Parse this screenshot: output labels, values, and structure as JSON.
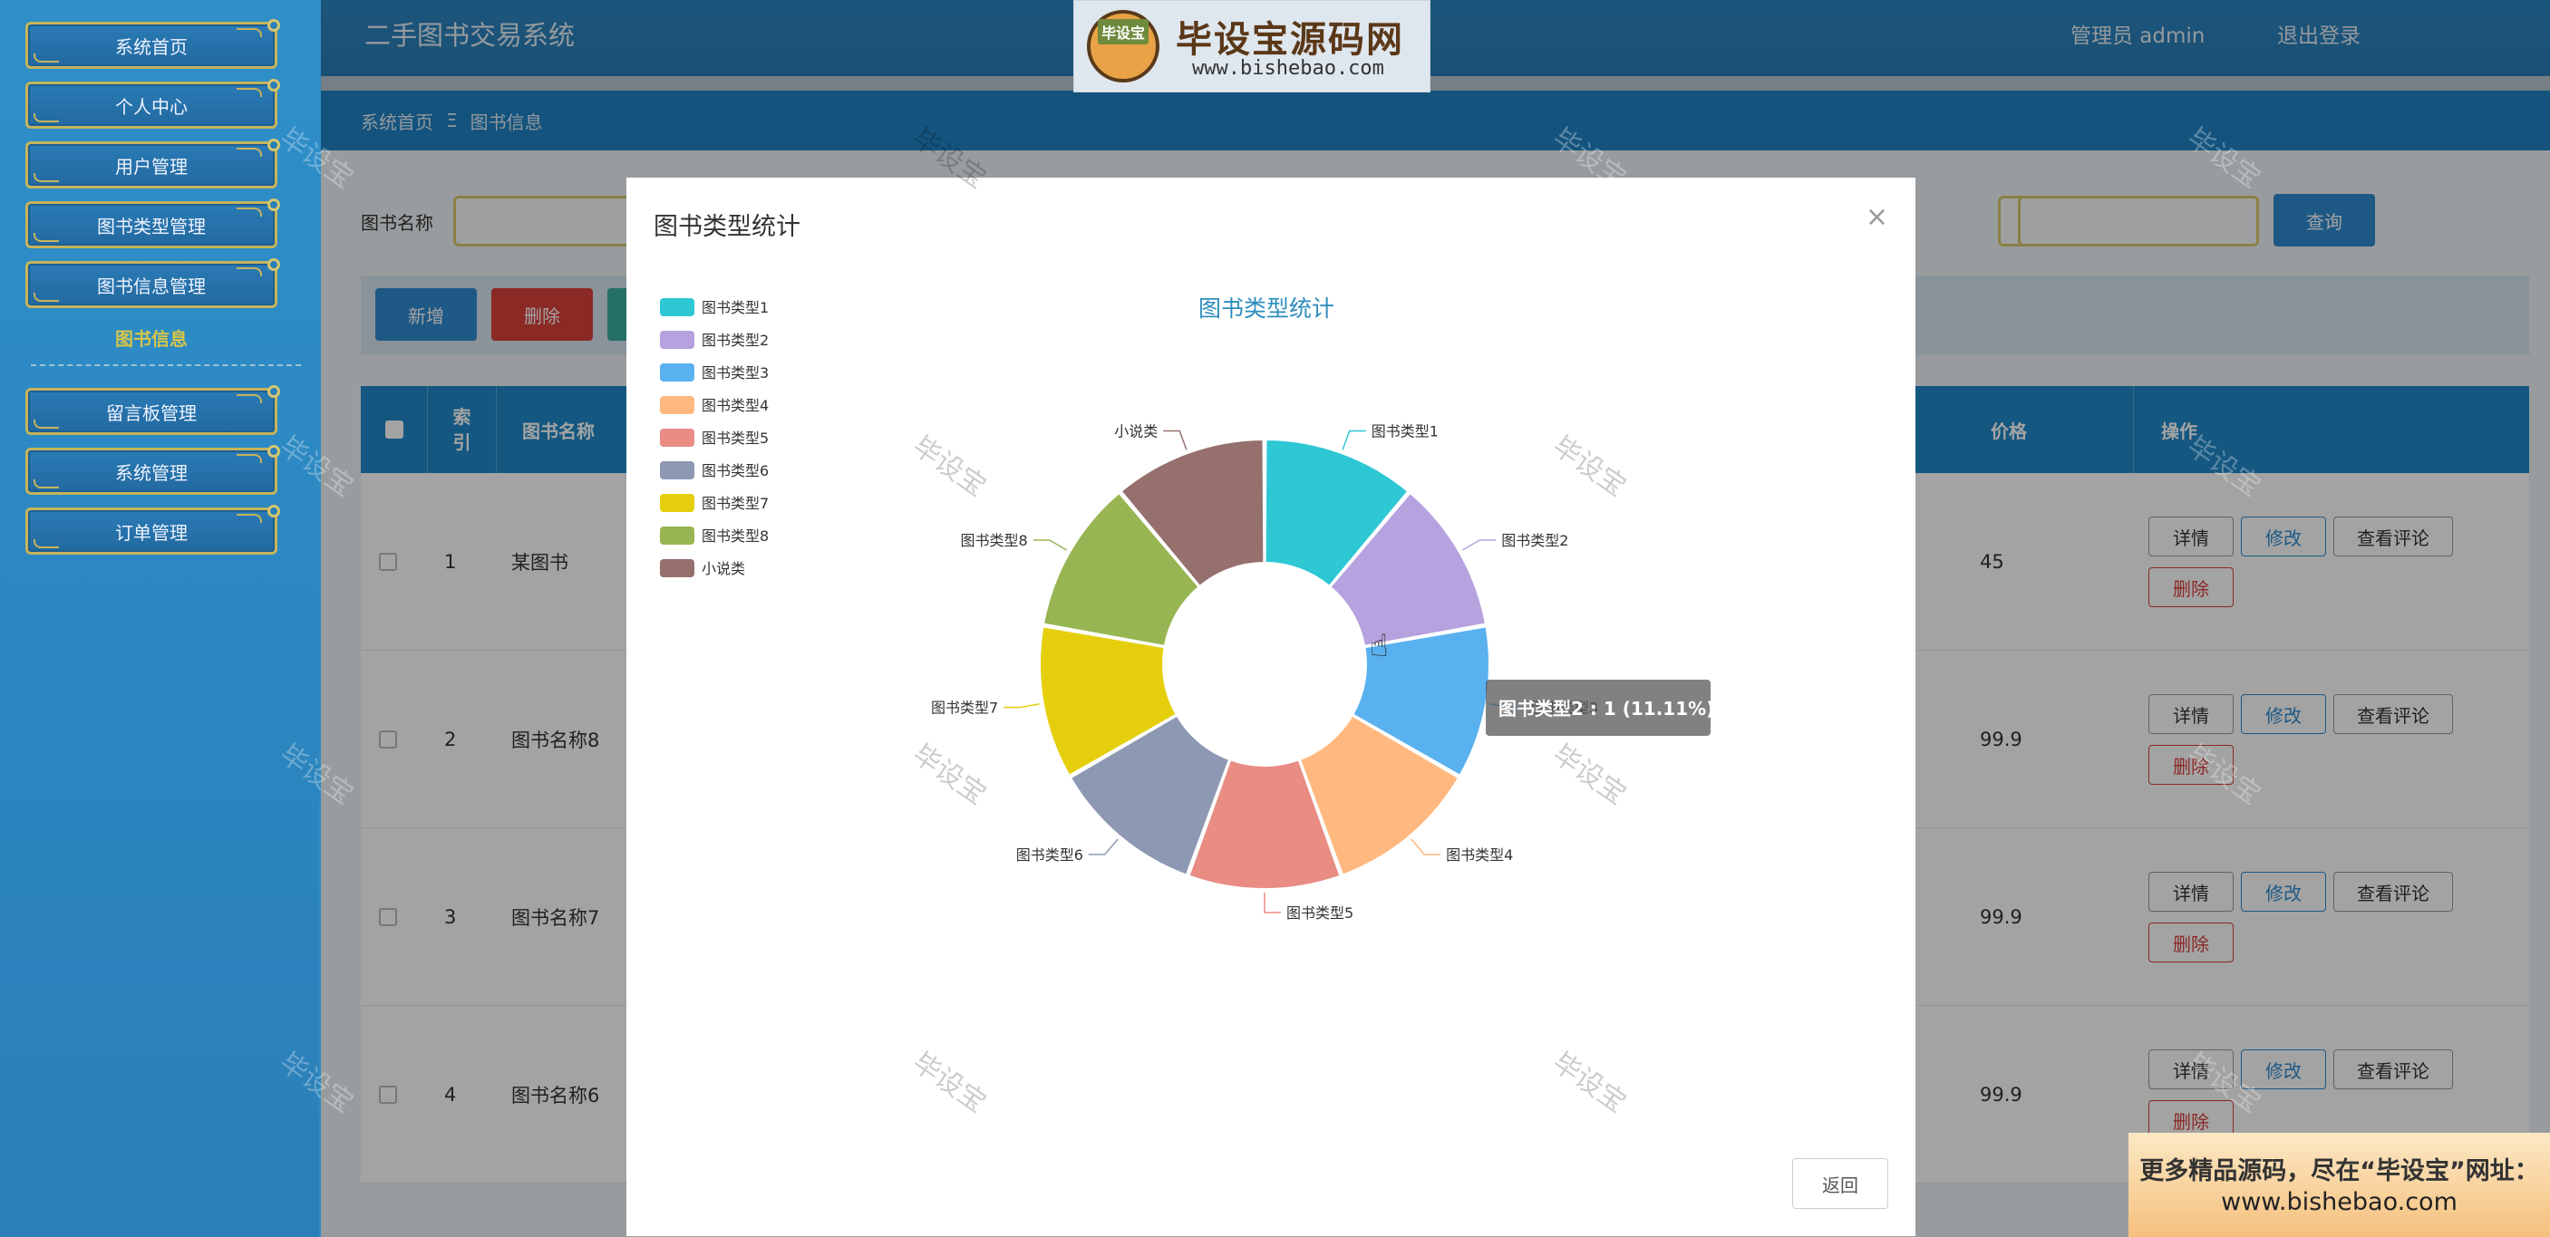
{
  "sidebar": {
    "items": [
      {
        "label": "系统首页"
      },
      {
        "label": "个人中心"
      },
      {
        "label": "用户管理"
      },
      {
        "label": "图书类型管理"
      },
      {
        "label": "图书信息管理"
      },
      {
        "label": "留言板管理"
      },
      {
        "label": "系统管理"
      },
      {
        "label": "订单管理"
      }
    ],
    "sub_item": "图书信息"
  },
  "header": {
    "title": "二手图书交易系统",
    "user": "管理员 admin",
    "logout": "退出登录"
  },
  "logo": {
    "badge": "毕设宝",
    "name": "毕设宝源码网",
    "url": "www.bishebao.com"
  },
  "breadcrumb": {
    "home": "系统首页",
    "separator": "Ξ",
    "current": "图书信息"
  },
  "search": {
    "label": "图书名称",
    "button": "查询"
  },
  "toolbar": {
    "add": "新增",
    "delete": "删除"
  },
  "table": {
    "headers": {
      "index": "索引",
      "name": "图书名称",
      "price": "价格",
      "ops": "操作"
    },
    "rows": [
      {
        "index": "1",
        "name": "某图书",
        "price": "45"
      },
      {
        "index": "2",
        "name": "图书名称8",
        "price": "99.9"
      },
      {
        "index": "3",
        "name": "图书名称7",
        "price": "99.9"
      },
      {
        "index": "4",
        "name": "图书名称6",
        "price": "99.9"
      }
    ],
    "ops": {
      "detail": "详情",
      "edit": "修改",
      "comments": "查看评论",
      "delete": "删除"
    }
  },
  "modal": {
    "title": "图书类型统计",
    "close_icon": "close-icon",
    "back": "返回"
  },
  "chart_data": {
    "type": "pie",
    "title": "图书类型统计",
    "donut": true,
    "legend_position": "top-left",
    "categories": [
      "图书类型1",
      "图书类型2",
      "图书类型3",
      "图书类型4",
      "图书类型5",
      "图书类型6",
      "图书类型7",
      "图书类型8",
      "小说类"
    ],
    "values": [
      1,
      1,
      1,
      1,
      1,
      1,
      1,
      1,
      1
    ],
    "colors": [
      "#2ec7d4",
      "#b6a2de",
      "#5ab1ef",
      "#ffb980",
      "#e88c84",
      "#8d98b3",
      "#e5cf0d",
      "#97b552",
      "#95706d"
    ],
    "tooltip": "图书类型2 : 1 (11.11%)"
  },
  "watermark": "毕设宝",
  "promo": {
    "line1": "更多精品源码，尽在“毕设宝”网址：",
    "line2": "www.bishebao.com"
  }
}
